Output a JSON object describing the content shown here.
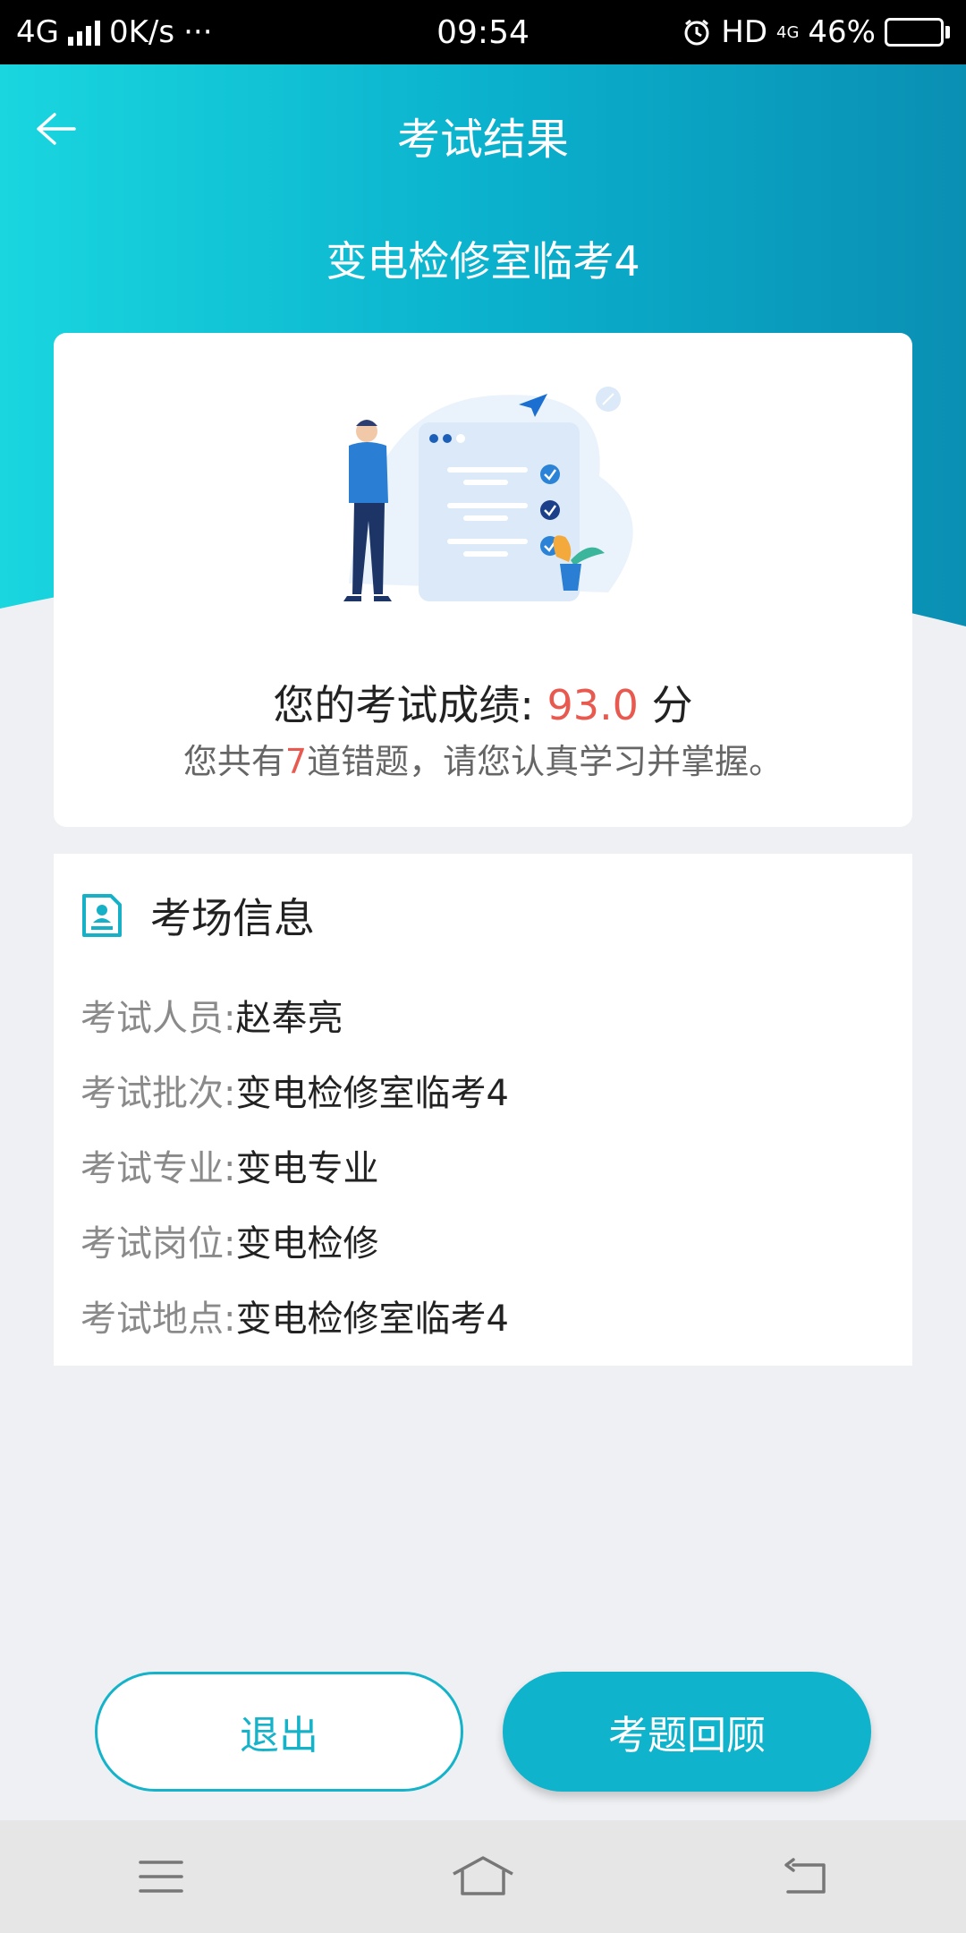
{
  "status_bar": {
    "network": "4G",
    "speed": "0K/s",
    "more": "···",
    "time": "09:54",
    "hd": "HD",
    "net_small": "4G",
    "battery": "46%",
    "battery_level": 0.46
  },
  "header": {
    "title": "考试结果",
    "exam_name": "变电检修室临考4"
  },
  "result": {
    "score_label": "您的考试成绩: ",
    "score": "93.0",
    "score_unit": " 分",
    "wrong_prefix": "您共有",
    "wrong_count": "7",
    "wrong_suffix": "道错题，请您认真学习并掌握。"
  },
  "info": {
    "title": "考场信息",
    "rows": [
      {
        "label": "考试人员: ",
        "value": "赵奉亮"
      },
      {
        "label": "考试批次: ",
        "value": "变电检修室临考4"
      },
      {
        "label": "考试专业: ",
        "value": "变电专业"
      },
      {
        "label": "考试岗位: ",
        "value": "变电检修"
      },
      {
        "label": "考试地点: ",
        "value": "变电检修室临考4"
      }
    ]
  },
  "buttons": {
    "exit": "退出",
    "review": "考题回顾"
  },
  "colors": {
    "accent": "#10b3cc",
    "score": "#e85a4f"
  }
}
